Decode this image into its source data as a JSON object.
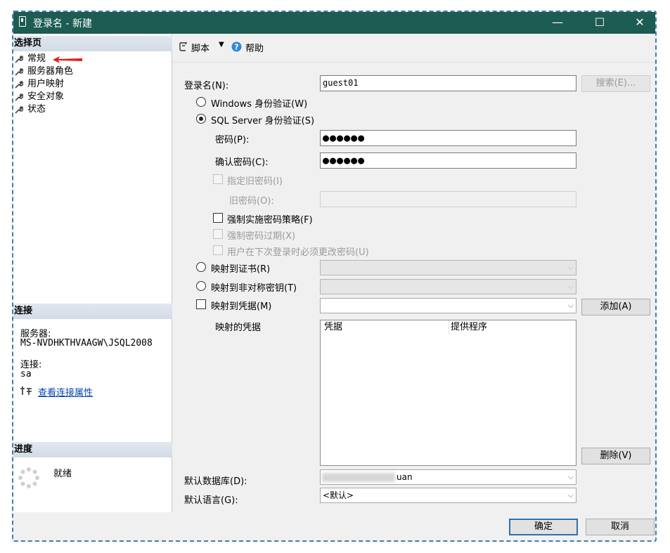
{
  "window": {
    "title": "登录名 - 新建",
    "minimize": "—",
    "maximize": "☐",
    "close": "✕"
  },
  "left_panel": {
    "select_page_header": "选择页",
    "pages": [
      {
        "label": "常规",
        "icon": "wrench-icon"
      },
      {
        "label": "服务器角色",
        "icon": "wrench-icon"
      },
      {
        "label": "用户映射",
        "icon": "wrench-icon"
      },
      {
        "label": "安全对象",
        "icon": "wrench-icon"
      },
      {
        "label": "状态",
        "icon": "wrench-icon"
      }
    ],
    "connection_header": "连接",
    "server_label": "服务器:",
    "server_value": "MS-NVDHKTHVAAGW\\JSQL2008",
    "connection_label": "连接:",
    "connection_value": "sa",
    "view_props_link": "查看连接属性",
    "progress_header": "进度",
    "progress_status": "就绪"
  },
  "toolbar": {
    "script_label": "脚本",
    "help_label": "帮助"
  },
  "form": {
    "login_name_label": "登录名(N):",
    "login_name_value": "guest01",
    "search_button": "搜索(E)...",
    "windows_auth_label": "Windows 身份验证(W)",
    "sql_auth_label": "SQL Server 身份验证(S)",
    "password_label": "密码(P):",
    "password_value": "●●●●●●",
    "confirm_password_label": "确认密码(C):",
    "confirm_password_value": "●●●●●●",
    "specify_old_password_label": "指定旧密码(I)",
    "old_password_label": "旧密码(O):",
    "enforce_policy_label": "强制实施密码策略(F)",
    "enforce_expiration_label": "强制密码过期(X)",
    "must_change_label": "用户在下次登录时必须更改密码(U)",
    "map_certificate_label": "映射到证书(R)",
    "map_asym_key_label": "映射到非对称密钥(T)",
    "map_credential_label": "映射到凭据(M)",
    "add_button": "添加(A)",
    "mapped_credentials_label": "映射的凭据",
    "grid_columns": [
      "凭据",
      "提供程序"
    ],
    "remove_button": "删除(V)",
    "default_db_label": "默认数据库(D):",
    "default_db_value": "uan",
    "default_lang_label": "默认语言(G):",
    "default_lang_value": "<默认>"
  },
  "footer": {
    "ok_button": "确定",
    "cancel_button": "取消"
  },
  "colors": {
    "titlebar": "#1d5c52",
    "link": "#0645ad",
    "accent_arrow": "#e02020"
  }
}
